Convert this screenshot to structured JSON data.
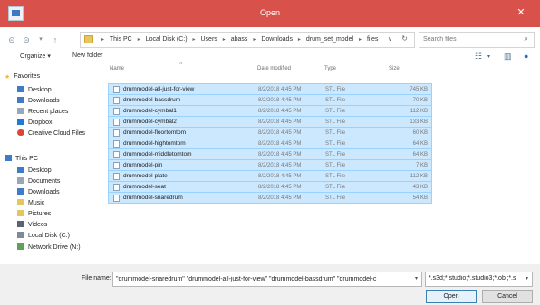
{
  "window": {
    "title": "Open"
  },
  "address": {
    "crumbs": [
      "This PC",
      "Local Disk (C:)",
      "Users",
      "abass",
      "Downloads",
      "drum_set_model",
      "files"
    ],
    "search_placeholder": "Search files"
  },
  "toolbar": {
    "organize": "Organize ▾",
    "new_folder": "New folder"
  },
  "columns": {
    "name": "Name",
    "date": "Date modified",
    "type": "Type",
    "size": "Size"
  },
  "files": [
    {
      "name": "drummodel-all-just-for-view",
      "date": "8/2/2018 4:45 PM",
      "type": "STL File",
      "size": "745 KB"
    },
    {
      "name": "drummodel-bassdrum",
      "date": "8/2/2018 4:45 PM",
      "type": "STL File",
      "size": "70 KB"
    },
    {
      "name": "drummodel-cymbal1",
      "date": "8/2/2018 4:45 PM",
      "type": "STL File",
      "size": "112 KB"
    },
    {
      "name": "drummodel-cymbal2",
      "date": "8/2/2018 4:45 PM",
      "type": "STL File",
      "size": "133 KB"
    },
    {
      "name": "drummodel-floortomtom",
      "date": "8/2/2018 4:45 PM",
      "type": "STL File",
      "size": "60 KB"
    },
    {
      "name": "drummodel-hightomtom",
      "date": "8/2/2018 4:45 PM",
      "type": "STL File",
      "size": "64 KB"
    },
    {
      "name": "drummodel-middletomtom",
      "date": "8/2/2018 4:45 PM",
      "type": "STL File",
      "size": "64 KB"
    },
    {
      "name": "drummodel-pin",
      "date": "8/2/2018 4:45 PM",
      "type": "STL File",
      "size": "7 KB"
    },
    {
      "name": "drummodel-plate",
      "date": "8/2/2018 4:45 PM",
      "type": "STL File",
      "size": "112 KB"
    },
    {
      "name": "drummodel-seat",
      "date": "8/2/2018 4:45 PM",
      "type": "STL File",
      "size": "43 KB"
    },
    {
      "name": "drummodel-snaredrum",
      "date": "8/2/2018 4:45 PM",
      "type": "STL File",
      "size": "54 KB"
    }
  ],
  "nav": {
    "favorites_label": "Favorites",
    "favorites": [
      "Desktop",
      "Downloads",
      "Recent places",
      "Dropbox",
      "Creative Cloud Files"
    ],
    "thispc_label": "This PC",
    "thispc": [
      "Desktop",
      "Documents",
      "Downloads",
      "Music",
      "Pictures",
      "Videos",
      "Local Disk (C:)",
      "Network Drive (N:)"
    ]
  },
  "bottom": {
    "filename_label": "File name:",
    "filename_value": "\"drummodel-snaredrum\" \"drummodel-all-just-for-view\" \"drummodel-bassdrum\" \"drummodel-c",
    "filetype_value": "*.s3d;*.studio;*.studio3;*.obj;*.s",
    "open_label": "Open",
    "cancel_label": "Cancel"
  },
  "colors": {
    "titlebar": "#d9514b",
    "selection": "#cce8ff",
    "selection_border": "#99d1ff"
  }
}
